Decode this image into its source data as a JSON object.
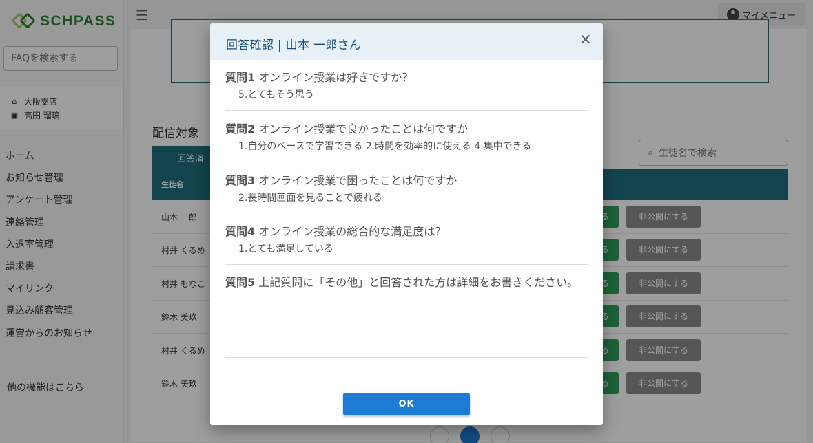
{
  "brand": {
    "name": "SCHPASS"
  },
  "sidebar": {
    "faq_placeholder": "FAQを検索する",
    "branch": "大阪支店",
    "user": "高田 瑠璃",
    "items": [
      {
        "label": "ホーム"
      },
      {
        "label": "お知らせ管理"
      },
      {
        "label": "アンケート管理"
      },
      {
        "label": "連絡管理"
      },
      {
        "label": "入退室管理"
      },
      {
        "label": "請求書"
      },
      {
        "label": "マイリンク"
      },
      {
        "label": "見込み顧客管理"
      },
      {
        "label": "運営からのお知らせ"
      }
    ],
    "other_link": "他の機能はこちら"
  },
  "topbar": {
    "my_menu": "マイメニュー"
  },
  "main": {
    "section_title": "配信対象",
    "tab_answered": "回答済",
    "search_placeholder": "生徒名で検索",
    "col_student": "生徒名",
    "rows": [
      {
        "name": "山本 一郎",
        "publish": "る",
        "hide": "非公開にする"
      },
      {
        "name": "村井 くるめ",
        "publish": "る",
        "hide": "非公開にする"
      },
      {
        "name": "村井 もなこ",
        "publish": "る",
        "hide": "非公開にする"
      },
      {
        "name": "鈴木 美玖",
        "publish": "る",
        "hide": "非公開にする"
      },
      {
        "name": "村井 くるめ",
        "publish": "る",
        "hide": "非公開にする"
      },
      {
        "name": "鈴木 美玖",
        "publish": "る",
        "hide": "非公開にする"
      }
    ]
  },
  "modal": {
    "title": "回答確認 | 山本 一郎さん",
    "close": "×",
    "ok": "OK",
    "questions": [
      {
        "num": "質問1",
        "text": " オンライン授業は好きですか？",
        "answer": "5.とてもそう思う"
      },
      {
        "num": "質問2",
        "text": " オンライン授業で良かったことは何ですか",
        "answer": "1.自分のペースで学習できる 2.時間を効率的に使える 4.集中できる"
      },
      {
        "num": "質問3",
        "text": " オンライン授業で困ったことは何ですか",
        "answer": "2.長時間画面を見ることで疲れる"
      },
      {
        "num": "質問4",
        "text": " オンライン授業の総合的な満足度は？",
        "answer": "1.とても満足している"
      },
      {
        "num": "質問5",
        "text": " 上記質問に「その他」と回答された方は詳細をお書きください。",
        "answer": ""
      }
    ]
  },
  "colors": {
    "teal": "#1f6c7b",
    "brand_green": "#2e7d32",
    "ok_blue": "#1e7bd4",
    "publish_green": "#2e9e5b"
  }
}
